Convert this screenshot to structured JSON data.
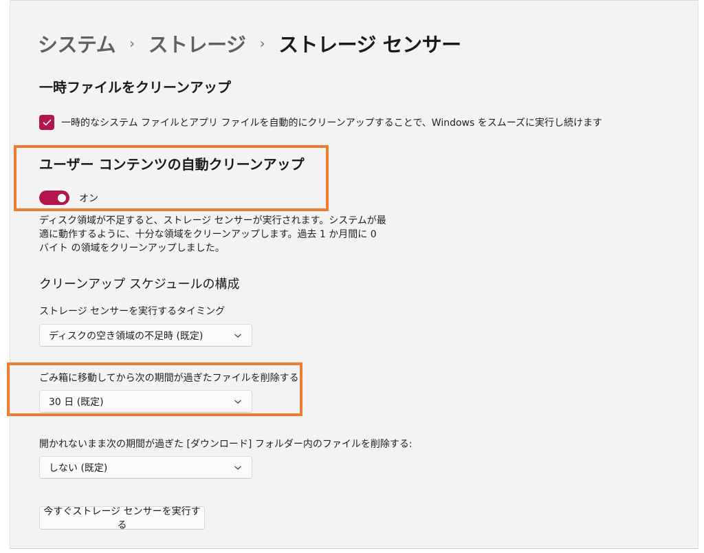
{
  "breadcrumb": {
    "items": [
      "システム",
      "ストレージ"
    ],
    "current": "ストレージ センサー"
  },
  "temp_files": {
    "heading": "一時ファイルをクリーンアップ",
    "checkbox_label": "一時的なシステム ファイルとアプリ ファイルを自動的にクリーンアップすることで、Windows をスムーズに実行し続けます",
    "checked": true
  },
  "auto_cleanup": {
    "heading": "ユーザー コンテンツの自動クリーンアップ",
    "toggle_state_label": "オン",
    "toggle_on": true,
    "description": "ディスク領域が不足すると、ストレージ センサーが実行されます。システムが最適に動作するように、十分な領域をクリーンアップします。過去 1 か月間に 0 バイト の領域をクリーンアップしました。"
  },
  "schedule": {
    "heading": "クリーンアップ スケジュールの構成",
    "run_timing": {
      "label": "ストレージ センサーを実行するタイミング",
      "value": "ディスクの空き領域の不足時 (既定)"
    },
    "recycle_bin": {
      "label": "ごみ箱に移動してから次の期間が過ぎたファイルを削除する:",
      "value": "30 日 (既定)"
    },
    "downloads": {
      "label": "開かれないまま次の期間が過ぎた [ダウンロード] フォルダー内のファイルを削除する:",
      "value": "しない (既定)"
    }
  },
  "run_now_button": "今すぐストレージ センサーを実行する",
  "colors": {
    "accent": "#b3164f",
    "highlight": "#ed7d31",
    "background": "#f3f3f3"
  }
}
